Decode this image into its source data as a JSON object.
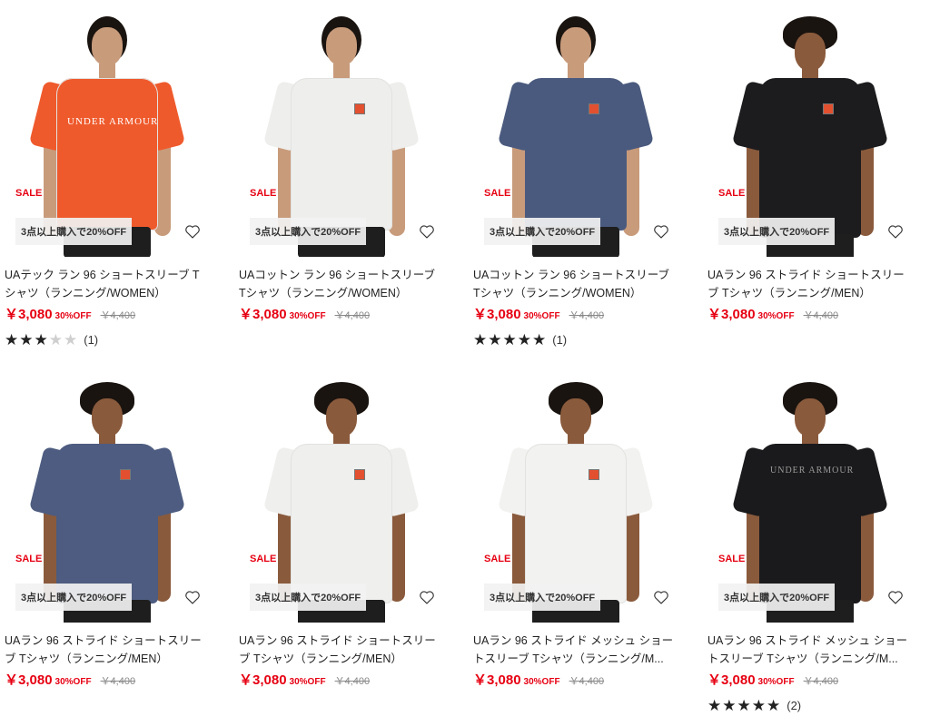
{
  "products": [
    {
      "sale": "SALE",
      "promo": "3点以上購入で20%OFF",
      "name": "UAテック ラン 96 ショートスリーブ Tシャツ（ランニング/WOMEN）",
      "price": "￥3,080",
      "discount": "30%OFF",
      "original": "￥4,400",
      "rating": 3,
      "review_count": "(1)",
      "shirt_color": "#ef5a2c",
      "model": "woman",
      "chest_text": "UNDER ARMOUR"
    },
    {
      "sale": "SALE",
      "promo": "3点以上購入で20%OFF",
      "name": "UAコットン ラン 96 ショートスリーブ Tシャツ（ランニング/WOMEN）",
      "price": "￥3,080",
      "discount": "30%OFF",
      "original": "￥4,400",
      "shirt_color": "#eeeeec",
      "model": "woman"
    },
    {
      "sale": "SALE",
      "promo": "3点以上購入で20%OFF",
      "name": "UAコットン ラン 96 ショートスリーブ Tシャツ（ランニング/WOMEN）",
      "price": "￥3,080",
      "discount": "30%OFF",
      "original": "￥4,400",
      "rating": 5,
      "review_count": "(1)",
      "shirt_color": "#4a5a7e",
      "model": "woman"
    },
    {
      "sale": "SALE",
      "promo": "3点以上購入で20%OFF",
      "name": "UAラン 96 ストライド ショートスリーブ Tシャツ（ランニング/MEN）",
      "price": "￥3,080",
      "discount": "30%OFF",
      "original": "￥4,400",
      "shirt_color": "#1c1c1e",
      "model": "man"
    },
    {
      "sale": "SALE",
      "promo": "3点以上購入で20%OFF",
      "name": "UAラン 96 ストライド ショートスリーブ Tシャツ（ランニング/MEN）",
      "price": "￥3,080",
      "discount": "30%OFF",
      "original": "￥4,400",
      "shirt_color": "#4d5c80",
      "model": "man"
    },
    {
      "sale": "SALE",
      "promo": "3点以上購入で20%OFF",
      "name": "UAラン 96 ストライド ショートスリーブ Tシャツ（ランニング/MEN）",
      "price": "￥3,080",
      "discount": "30%OFF",
      "original": "￥4,400",
      "shirt_color": "#efefed",
      "model": "man"
    },
    {
      "sale": "SALE",
      "promo": "3点以上購入で20%OFF",
      "name": "UAラン 96 ストライド メッシュ ショートスリーブ Tシャツ（ランニング/M...",
      "price": "￥3,080",
      "discount": "30%OFF",
      "original": "￥4,400",
      "shirt_color": "#f2f2f0",
      "model": "man"
    },
    {
      "sale": "SALE",
      "promo": "3点以上購入で20%OFF",
      "name": "UAラン 96 ストライド メッシュ ショートスリーブ Tシャツ（ランニング/M...",
      "price": "￥3,080",
      "discount": "30%OFF",
      "original": "￥4,400",
      "rating": 5,
      "review_count": "(2)",
      "shirt_color": "#1a1a1c",
      "model": "man",
      "chest_text": "UNDER ARMOUR"
    }
  ]
}
